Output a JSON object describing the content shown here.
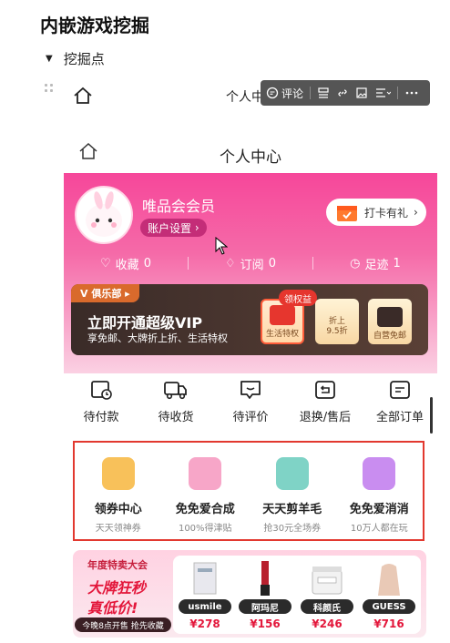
{
  "doc": {
    "title": "内嵌游戏挖掘",
    "toggle_label": "挖掘点"
  },
  "toolbar": {
    "comment_label": "评论"
  },
  "page": {
    "header_title": "个人中心",
    "header_title_partial": "个人中"
  },
  "profile": {
    "member_name": "唯品会会员",
    "account_settings": "账户设置",
    "clockin_label": "打卡有礼",
    "stats": [
      {
        "label": "收藏",
        "count": "0"
      },
      {
        "label": "订阅",
        "count": "0"
      },
      {
        "label": "足迹",
        "count": "1"
      }
    ]
  },
  "vip": {
    "club_label": "俱乐部",
    "title": "立即开通超级VIP",
    "subtitle": "享免邮、大牌折上折、生活特权",
    "badge": "领权益",
    "perks": [
      {
        "label": "生活特权"
      },
      {
        "label": "折上\n9.5折"
      },
      {
        "label": "自营免邮"
      }
    ]
  },
  "orders": [
    {
      "label": "待付款",
      "icon": "wallet-icon"
    },
    {
      "label": "待收货",
      "icon": "truck-icon"
    },
    {
      "label": "待评价",
      "icon": "comment-icon"
    },
    {
      "label": "退换/售后",
      "icon": "return-icon"
    },
    {
      "label": "全部订单",
      "icon": "list-icon"
    }
  ],
  "services": [
    {
      "title": "领券中心",
      "subtitle": "天天领神券",
      "color": "#f8c15a"
    },
    {
      "title": "免免爱合成",
      "subtitle": "100%得津贴",
      "color": "#f7a6c8"
    },
    {
      "title": "天天剪羊毛",
      "subtitle": "抢30元全场券",
      "color": "#7fd3c6"
    },
    {
      "title": "免免爱消消",
      "subtitle": "10万人都在玩",
      "color": "#c98df0"
    }
  ],
  "banner": {
    "tag": "年度特卖大会",
    "headline1": "大牌狂秒",
    "headline2": "真低价!",
    "footer": "今晚8点开售 抢先收藏",
    "products": [
      {
        "brand": "usmile",
        "price": "¥278",
        "color": "#e8e8ee"
      },
      {
        "brand": "阿玛尼",
        "price": "¥156",
        "color": "#b8202e"
      },
      {
        "brand": "科颜氏",
        "price": "¥246",
        "color": "#f2f2f2"
      },
      {
        "brand": "GUESS",
        "price": "¥716",
        "color": "#e9c9b6"
      }
    ]
  },
  "colors": {
    "accent": "#f6479a",
    "highlight_border": "#e2382f",
    "price": "#e3173b"
  }
}
